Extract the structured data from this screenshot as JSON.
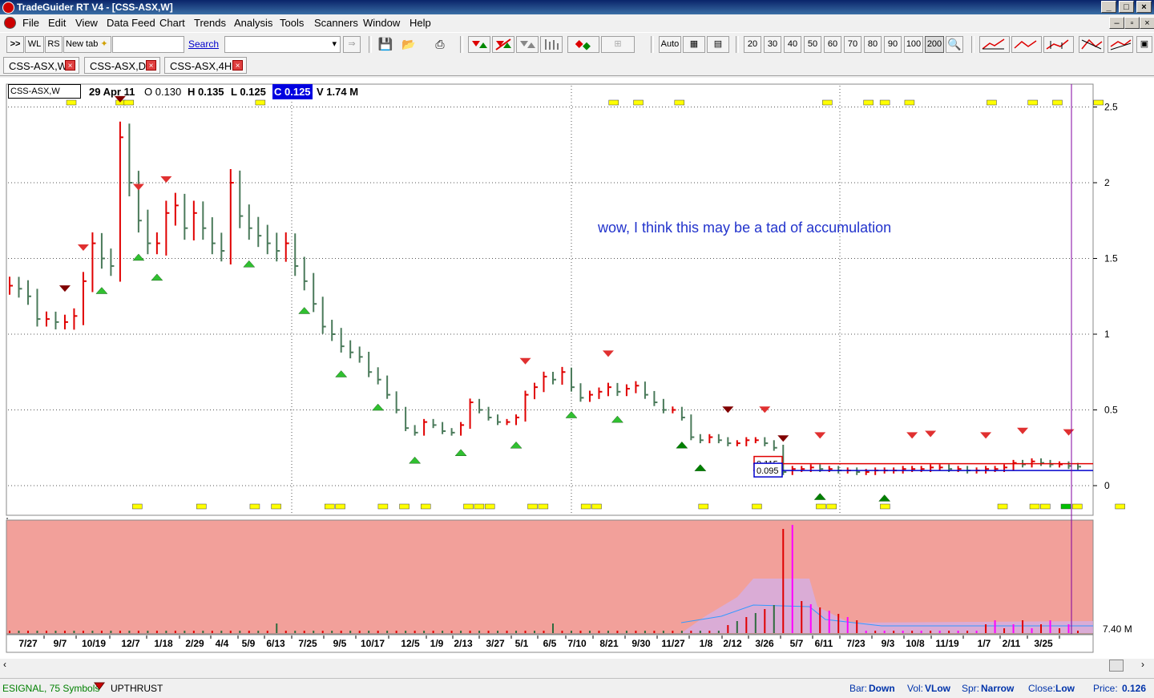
{
  "window": {
    "title": "TradeGuider RT V4  - [CSS-ASX,W]",
    "min_glyph": "_",
    "max_glyph": "□",
    "close_glyph": "×",
    "mdi_min_glyph": "–",
    "mdi_restore_glyph": "▫",
    "mdi_close_glyph": "×"
  },
  "menu": [
    "File",
    "Edit",
    "View",
    "Data Feed",
    "Chart",
    "Trends",
    "Analysis",
    "Tools",
    "Scanners",
    "Window",
    "Help"
  ],
  "toolbar": {
    "forward_glyph": ">>",
    "wl_label": "WL",
    "rs_label": "RS",
    "new_tab_label": "New tab",
    "search_label": "Search",
    "go_glyph": "⇒",
    "auto_label": "Auto",
    "period_buttons": [
      "20",
      "30",
      "40",
      "50",
      "60",
      "70",
      "80",
      "90",
      "100",
      "200"
    ],
    "selected_period": "200"
  },
  "tabs": [
    {
      "label": "CSS-ASX,W"
    },
    {
      "label": "CSS-ASX,D"
    },
    {
      "label": "CSS-ASX,4H"
    }
  ],
  "tab_close_glyph": "×",
  "chart_info": {
    "symbol": "CSS-ASX,W",
    "date": "29 Apr 11",
    "open": "O 0.130",
    "high": "H 0.135",
    "low": "L 0.125",
    "close": "C 0.125",
    "volume": "V 1.74 M"
  },
  "annotation": "wow, I think this may be a tad of accumulation",
  "status": {
    "feed": "ESIGNAL, 75 Symbols",
    "signal": "UPTHRUST",
    "bar_label": "Bar:",
    "bar_value": "Down",
    "vol_label": "Vol:",
    "vol_value": "VLow",
    "spr_label": "Spr:",
    "spr_value": "Narrow",
    "close_label": "Close:",
    "close_value": "Low",
    "price_label": "Price:",
    "price_value": "0.126"
  },
  "colors": {
    "up_bar": "#e00000",
    "down_bar": "#4a7a5a",
    "volume_panel_bg": "#f2a09a",
    "signal_box": "#ffff00",
    "support_line": "#0000cc",
    "resistance_line": "#e00000"
  },
  "chart_data": {
    "type": "ohlc",
    "y_ticks": [
      "2.5",
      "2",
      "1.5",
      "1",
      "0.5",
      "0"
    ],
    "ylim": [
      0,
      2.6
    ],
    "x_ticks": [
      "7/27",
      "9/7",
      "10/19",
      "12/7",
      "1/18",
      "2/29",
      "4/4",
      "5/9",
      "6/13",
      "7/25",
      "9/5",
      "10/17",
      "12/5",
      "1/9",
      "2/13",
      "3/27",
      "5/1",
      "6/5",
      "7/10",
      "8/21",
      "9/30",
      "11/27",
      "1/8",
      "2/12",
      "3/26",
      "5/7",
      "6/11",
      "7/23",
      "9/3",
      "10/8",
      "11/19",
      "1/7",
      "2/11",
      "3/25"
    ],
    "price_labels": [
      "0.115",
      "0.095"
    ],
    "resistance_level": 0.145,
    "support_level": 0.1,
    "close_series": [
      1.32,
      1.3,
      1.25,
      1.1,
      1.1,
      1.08,
      1.08,
      1.12,
      1.35,
      1.6,
      1.5,
      1.45,
      2.3,
      2.0,
      1.75,
      1.6,
      1.6,
      1.8,
      1.85,
      1.7,
      1.8,
      1.7,
      1.6,
      1.55,
      2.0,
      1.78,
      1.7,
      1.65,
      1.6,
      1.55,
      1.6,
      1.45,
      1.35,
      1.2,
      1.05,
      1.0,
      0.92,
      0.88,
      0.85,
      0.75,
      0.7,
      0.6,
      0.5,
      0.38,
      0.35,
      0.42,
      0.4,
      0.36,
      0.35,
      0.4,
      0.55,
      0.5,
      0.45,
      0.42,
      0.42,
      0.45,
      0.6,
      0.65,
      0.72,
      0.7,
      0.75,
      0.65,
      0.58,
      0.6,
      0.62,
      0.65,
      0.62,
      0.64,
      0.66,
      0.6,
      0.55,
      0.5,
      0.5,
      0.45,
      0.32,
      0.3,
      0.32,
      0.3,
      0.28,
      0.28,
      0.3,
      0.3,
      0.28,
      0.25,
      0.09,
      0.11,
      0.11,
      0.12,
      0.11,
      0.11,
      0.1,
      0.1,
      0.09,
      0.09,
      0.1,
      0.1,
      0.1,
      0.11,
      0.11,
      0.11,
      0.12,
      0.12,
      0.11,
      0.11,
      0.1,
      0.1,
      0.11,
      0.11,
      0.12,
      0.15,
      0.14,
      0.16,
      0.15,
      0.14,
      0.14,
      0.13,
      0.125
    ],
    "volume_label": "7.40 M",
    "upthrust_markers": 19,
    "support_markers": 18
  }
}
